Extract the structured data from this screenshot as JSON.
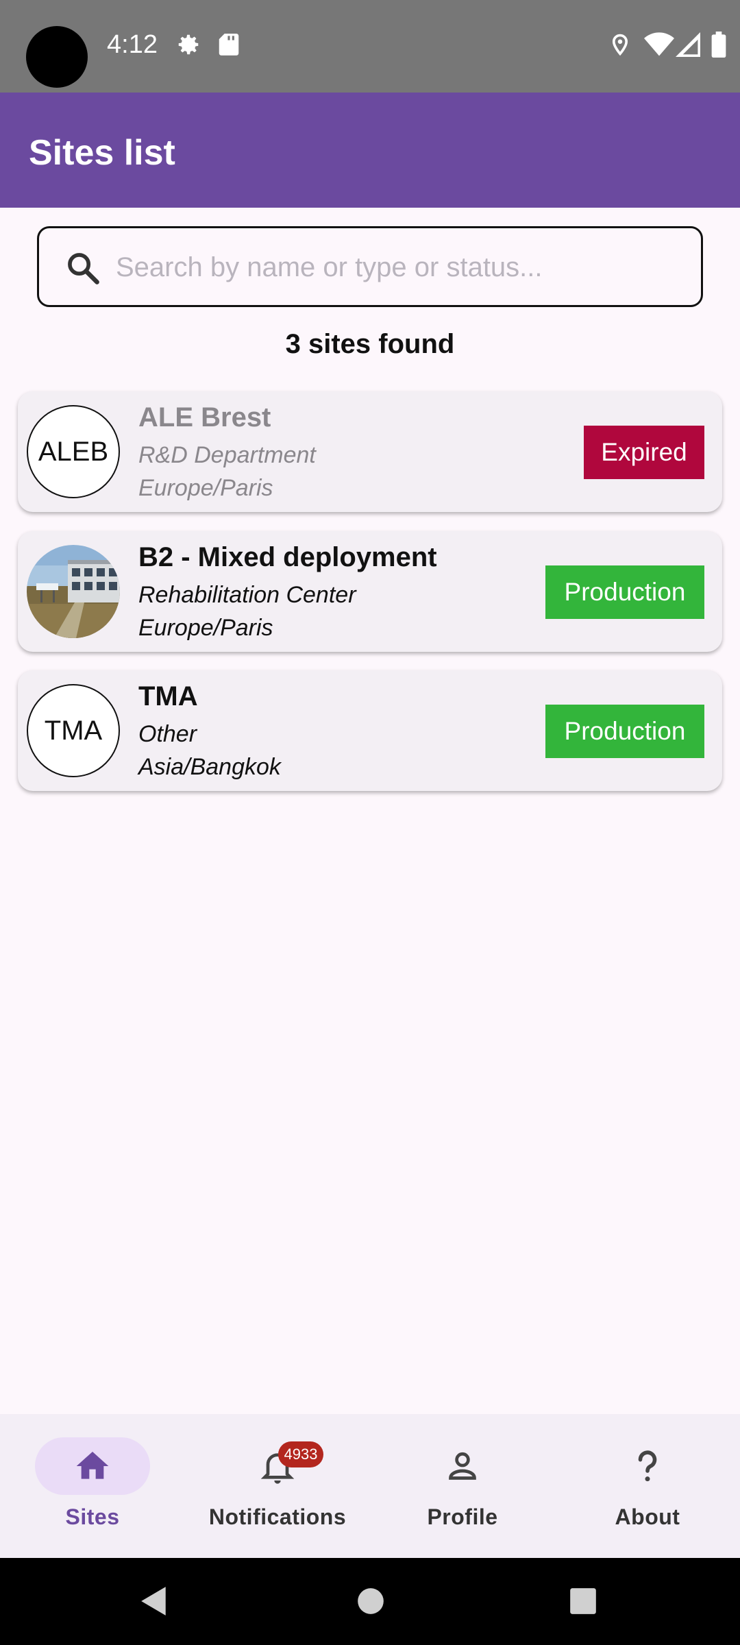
{
  "status_bar": {
    "time": "4:12",
    "icons": [
      "gear-icon",
      "sd-card-icon",
      "location-icon",
      "wifi-icon",
      "signal-icon",
      "battery-icon"
    ]
  },
  "app_bar": {
    "title": "Sites list"
  },
  "search": {
    "placeholder": "Search by name or type or status...",
    "value": ""
  },
  "result_count": "3 sites found",
  "sites": [
    {
      "initials": "ALEB",
      "name": "ALE Brest",
      "type": "R&D Department",
      "timezone": "Europe/Paris",
      "status": "Expired",
      "status_color": "#b0073d",
      "avatar": "initials"
    },
    {
      "initials": "",
      "name": "B2 - Mixed deployment",
      "type": "Rehabilitation Center",
      "timezone": "Europe/Paris",
      "status": "Production",
      "status_color": "#33b53b",
      "avatar": "building-photo"
    },
    {
      "initials": "TMA",
      "name": "TMA",
      "type": "Other",
      "timezone": "Asia/Bangkok",
      "status": "Production",
      "status_color": "#33b53b",
      "avatar": "initials"
    }
  ],
  "bottom_nav": {
    "items": [
      {
        "label": "Sites",
        "icon": "home-icon",
        "active": true
      },
      {
        "label": "Notifications",
        "icon": "bell-icon",
        "badge": "4933"
      },
      {
        "label": "Profile",
        "icon": "person-icon"
      },
      {
        "label": "About",
        "icon": "question-mark-icon"
      }
    ]
  },
  "colors": {
    "primary": "#6b4a9f",
    "expired": "#b0073d",
    "production": "#33b53b",
    "notification_badge": "#b3261e"
  }
}
